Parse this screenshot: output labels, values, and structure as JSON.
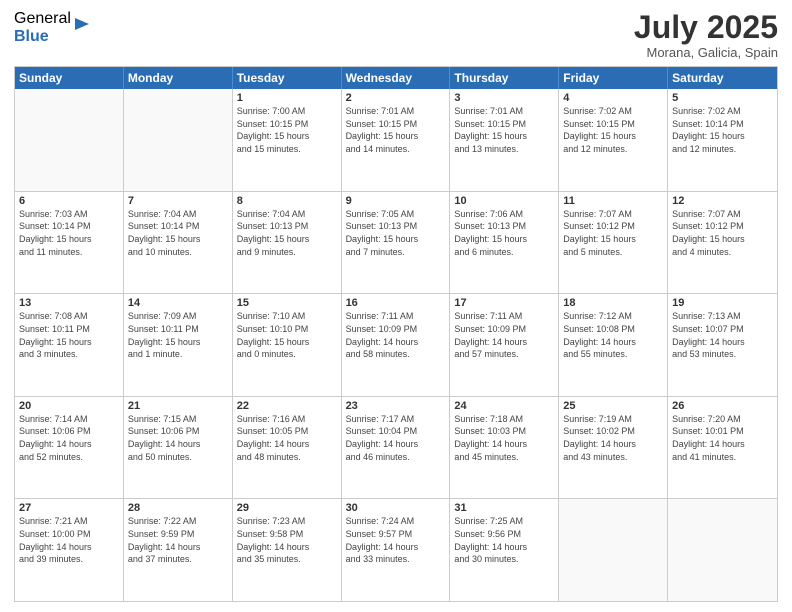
{
  "header": {
    "logo_general": "General",
    "logo_blue": "Blue",
    "month_title": "July 2025",
    "location": "Morana, Galicia, Spain"
  },
  "weekdays": [
    "Sunday",
    "Monday",
    "Tuesday",
    "Wednesday",
    "Thursday",
    "Friday",
    "Saturday"
  ],
  "rows": [
    [
      {
        "day": "",
        "lines": []
      },
      {
        "day": "",
        "lines": []
      },
      {
        "day": "1",
        "lines": [
          "Sunrise: 7:00 AM",
          "Sunset: 10:15 PM",
          "Daylight: 15 hours",
          "and 15 minutes."
        ]
      },
      {
        "day": "2",
        "lines": [
          "Sunrise: 7:01 AM",
          "Sunset: 10:15 PM",
          "Daylight: 15 hours",
          "and 14 minutes."
        ]
      },
      {
        "day": "3",
        "lines": [
          "Sunrise: 7:01 AM",
          "Sunset: 10:15 PM",
          "Daylight: 15 hours",
          "and 13 minutes."
        ]
      },
      {
        "day": "4",
        "lines": [
          "Sunrise: 7:02 AM",
          "Sunset: 10:15 PM",
          "Daylight: 15 hours",
          "and 12 minutes."
        ]
      },
      {
        "day": "5",
        "lines": [
          "Sunrise: 7:02 AM",
          "Sunset: 10:14 PM",
          "Daylight: 15 hours",
          "and 12 minutes."
        ]
      }
    ],
    [
      {
        "day": "6",
        "lines": [
          "Sunrise: 7:03 AM",
          "Sunset: 10:14 PM",
          "Daylight: 15 hours",
          "and 11 minutes."
        ]
      },
      {
        "day": "7",
        "lines": [
          "Sunrise: 7:04 AM",
          "Sunset: 10:14 PM",
          "Daylight: 15 hours",
          "and 10 minutes."
        ]
      },
      {
        "day": "8",
        "lines": [
          "Sunrise: 7:04 AM",
          "Sunset: 10:13 PM",
          "Daylight: 15 hours",
          "and 9 minutes."
        ]
      },
      {
        "day": "9",
        "lines": [
          "Sunrise: 7:05 AM",
          "Sunset: 10:13 PM",
          "Daylight: 15 hours",
          "and 7 minutes."
        ]
      },
      {
        "day": "10",
        "lines": [
          "Sunrise: 7:06 AM",
          "Sunset: 10:13 PM",
          "Daylight: 15 hours",
          "and 6 minutes."
        ]
      },
      {
        "day": "11",
        "lines": [
          "Sunrise: 7:07 AM",
          "Sunset: 10:12 PM",
          "Daylight: 15 hours",
          "and 5 minutes."
        ]
      },
      {
        "day": "12",
        "lines": [
          "Sunrise: 7:07 AM",
          "Sunset: 10:12 PM",
          "Daylight: 15 hours",
          "and 4 minutes."
        ]
      }
    ],
    [
      {
        "day": "13",
        "lines": [
          "Sunrise: 7:08 AM",
          "Sunset: 10:11 PM",
          "Daylight: 15 hours",
          "and 3 minutes."
        ]
      },
      {
        "day": "14",
        "lines": [
          "Sunrise: 7:09 AM",
          "Sunset: 10:11 PM",
          "Daylight: 15 hours",
          "and 1 minute."
        ]
      },
      {
        "day": "15",
        "lines": [
          "Sunrise: 7:10 AM",
          "Sunset: 10:10 PM",
          "Daylight: 15 hours",
          "and 0 minutes."
        ]
      },
      {
        "day": "16",
        "lines": [
          "Sunrise: 7:11 AM",
          "Sunset: 10:09 PM",
          "Daylight: 14 hours",
          "and 58 minutes."
        ]
      },
      {
        "day": "17",
        "lines": [
          "Sunrise: 7:11 AM",
          "Sunset: 10:09 PM",
          "Daylight: 14 hours",
          "and 57 minutes."
        ]
      },
      {
        "day": "18",
        "lines": [
          "Sunrise: 7:12 AM",
          "Sunset: 10:08 PM",
          "Daylight: 14 hours",
          "and 55 minutes."
        ]
      },
      {
        "day": "19",
        "lines": [
          "Sunrise: 7:13 AM",
          "Sunset: 10:07 PM",
          "Daylight: 14 hours",
          "and 53 minutes."
        ]
      }
    ],
    [
      {
        "day": "20",
        "lines": [
          "Sunrise: 7:14 AM",
          "Sunset: 10:06 PM",
          "Daylight: 14 hours",
          "and 52 minutes."
        ]
      },
      {
        "day": "21",
        "lines": [
          "Sunrise: 7:15 AM",
          "Sunset: 10:06 PM",
          "Daylight: 14 hours",
          "and 50 minutes."
        ]
      },
      {
        "day": "22",
        "lines": [
          "Sunrise: 7:16 AM",
          "Sunset: 10:05 PM",
          "Daylight: 14 hours",
          "and 48 minutes."
        ]
      },
      {
        "day": "23",
        "lines": [
          "Sunrise: 7:17 AM",
          "Sunset: 10:04 PM",
          "Daylight: 14 hours",
          "and 46 minutes."
        ]
      },
      {
        "day": "24",
        "lines": [
          "Sunrise: 7:18 AM",
          "Sunset: 10:03 PM",
          "Daylight: 14 hours",
          "and 45 minutes."
        ]
      },
      {
        "day": "25",
        "lines": [
          "Sunrise: 7:19 AM",
          "Sunset: 10:02 PM",
          "Daylight: 14 hours",
          "and 43 minutes."
        ]
      },
      {
        "day": "26",
        "lines": [
          "Sunrise: 7:20 AM",
          "Sunset: 10:01 PM",
          "Daylight: 14 hours",
          "and 41 minutes."
        ]
      }
    ],
    [
      {
        "day": "27",
        "lines": [
          "Sunrise: 7:21 AM",
          "Sunset: 10:00 PM",
          "Daylight: 14 hours",
          "and 39 minutes."
        ]
      },
      {
        "day": "28",
        "lines": [
          "Sunrise: 7:22 AM",
          "Sunset: 9:59 PM",
          "Daylight: 14 hours",
          "and 37 minutes."
        ]
      },
      {
        "day": "29",
        "lines": [
          "Sunrise: 7:23 AM",
          "Sunset: 9:58 PM",
          "Daylight: 14 hours",
          "and 35 minutes."
        ]
      },
      {
        "day": "30",
        "lines": [
          "Sunrise: 7:24 AM",
          "Sunset: 9:57 PM",
          "Daylight: 14 hours",
          "and 33 minutes."
        ]
      },
      {
        "day": "31",
        "lines": [
          "Sunrise: 7:25 AM",
          "Sunset: 9:56 PM",
          "Daylight: 14 hours",
          "and 30 minutes."
        ]
      },
      {
        "day": "",
        "lines": []
      },
      {
        "day": "",
        "lines": []
      }
    ]
  ]
}
